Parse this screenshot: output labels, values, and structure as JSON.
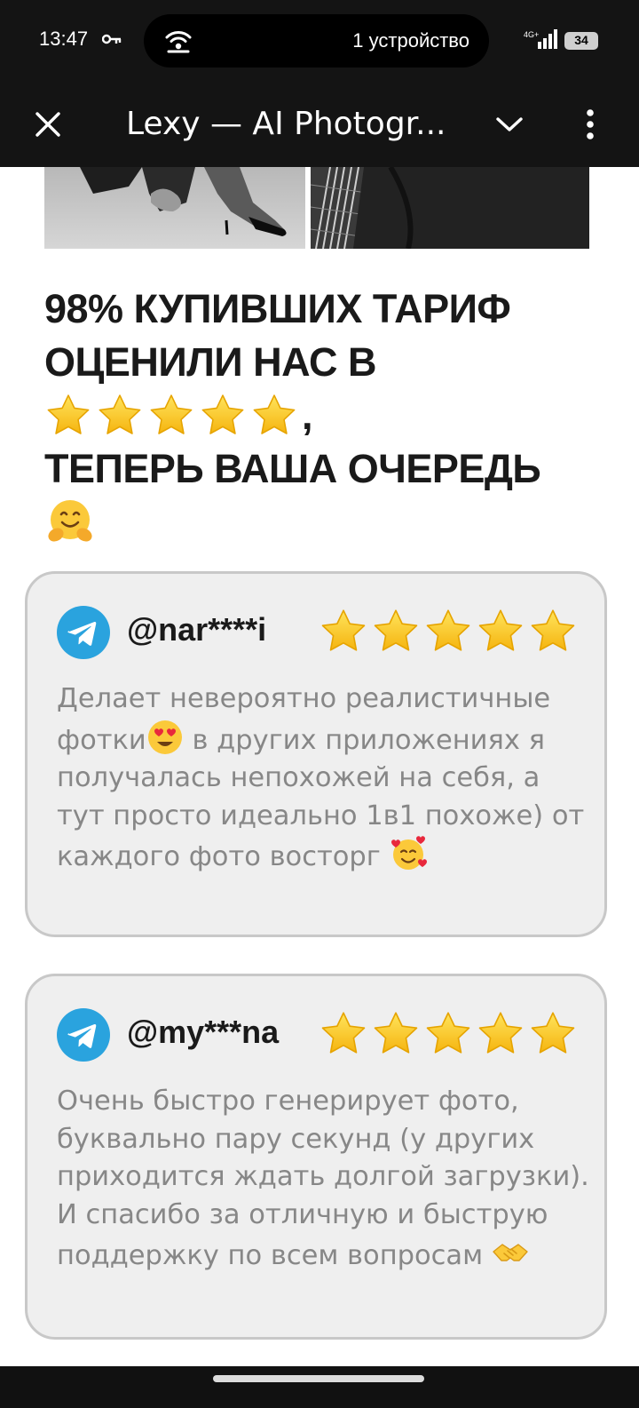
{
  "status_bar": {
    "time": "13:47",
    "hotspot_text": "1 устройство",
    "network": "4G+",
    "battery": "34",
    "icons": [
      "key-icon",
      "hotspot-icon",
      "signal-icon",
      "battery-icon"
    ]
  },
  "toolbar": {
    "title": "Lexy — AI Photogr...",
    "icons": [
      "close-icon",
      "chevron-down-icon",
      "more-vert-icon"
    ]
  },
  "headline": {
    "line1": "98% КУПИВШИХ ТАРИФ",
    "line2": "ОЦЕНИЛИ НАС В",
    "stars": 5,
    "comma": ",",
    "line3": "ТЕПЕРЬ ВАША ОЧЕРЕДЬ",
    "emoji": "hugging-face"
  },
  "reviews": [
    {
      "username": "@nar****i",
      "rating": 5,
      "text_part1": "Делает невероятно реалистичные фотки",
      "emoji1": "heart-eyes",
      "text_part2": " в других приложениях я получалась непохожей на себя, а тут просто идеально 1в1 похоже) от каждого фото восторг ",
      "emoji2": "smiling-face-with-hearts"
    },
    {
      "username": "@my***na",
      "rating": 5,
      "text_part1": "Очень быстро генерирует фото, буквально пару секунд (у других приходится ждать долгой загрузки). И спасибо за отличную и быструю поддержку по всем вопросам ",
      "emoji1": "handshake"
    }
  ],
  "colors": {
    "bar": "#141414",
    "star": "#f7c325",
    "telegram": "#2aa3de",
    "card_bg": "#efefef",
    "card_border": "#c8c8c8",
    "review_text": "#878787"
  }
}
